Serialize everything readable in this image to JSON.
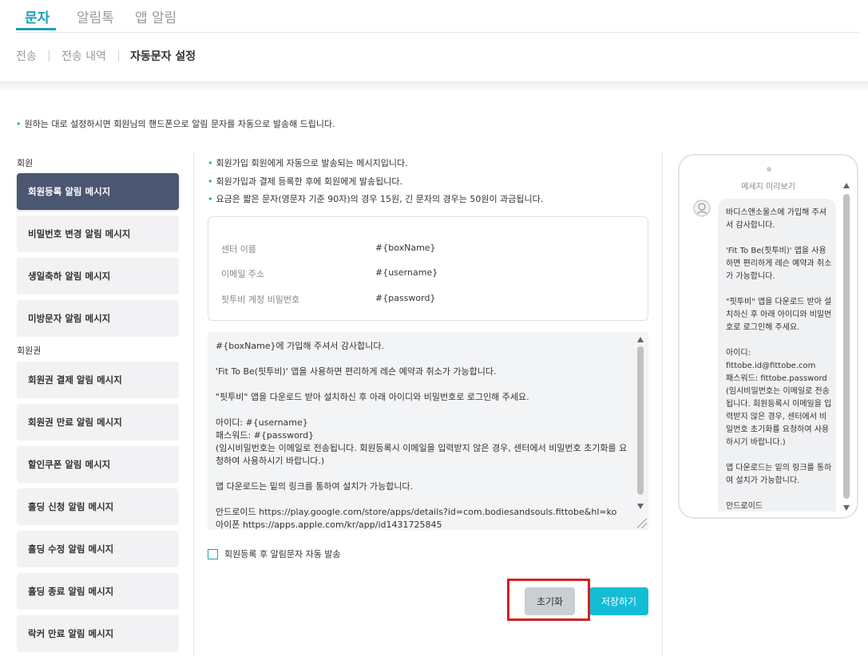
{
  "top_tabs": [
    {
      "label": "문자",
      "active": true
    },
    {
      "label": "알림톡",
      "active": false
    },
    {
      "label": "앱 알림",
      "active": false
    }
  ],
  "sub_tabs": [
    {
      "label": "전송"
    },
    {
      "label": "전송 내역"
    },
    {
      "label": "자동문자 설정",
      "active": true
    }
  ],
  "info": "원하는 대로 설정하시면 회원님의 핸드폰으로 알림 문자를 자동으로 발송해 드립니다.",
  "sidebar": {
    "groups": [
      {
        "label": "회원",
        "items": [
          "회원등록 알림 메시지",
          "비밀번호 변경 알림 메시지",
          "생일축하 알림 메시지",
          "미방문자 알림 메시지"
        ]
      },
      {
        "label": "회원권",
        "items": [
          "회원권 결제 알림 메시지",
          "회원권 만료 알림 메시지",
          "할인쿠폰 알림 메시지",
          "홀딩 신청 알림 메시지",
          "홀딩 수정 알림 메시지",
          "홀딩 종료 알림 메시지",
          "락커 만료 알림 메시지"
        ]
      }
    ],
    "active_item": "회원등록 알림 메시지"
  },
  "main": {
    "notes": [
      "회원가입 회원에게 자동으로 발송되는 메시지입니다.",
      "회원가입과 결제 등록한 후에 회원에게 발송됩니다.",
      "요금은 짧은 문자(영문자 기준 90자)의 경우 15원, 긴 문자의 경우는 50원이 과금됩니다."
    ],
    "variables": [
      {
        "name": "센터 이름",
        "value": "#{boxName}"
      },
      {
        "name": "이메일 주소",
        "value": "#{username}"
      },
      {
        "name": "핏투비 계정 비밀번호",
        "value": "#{password}"
      }
    ],
    "template_lines": [
      "#{boxName}에 가입해 주셔서 감사합니다.",
      "",
      "'Fit To Be(핏투비)' 앱을 사용하면 편리하게 레슨 예약과 취소가 가능합니다.",
      "",
      "\"핏투비\" 앱을 다운로드 받아 설치하신 후 아래 아이디와 비밀번호로 로그인해 주세요.",
      "",
      "아이디: #{username}",
      "패스워드: #{password}",
      "(임시비밀번호는 이메일로 전송됩니다. 회원등록시 이메일을 입력받지 않은 경우, 센터에서 비밀번호 초기화를 요청하여 사용하시기 바랍니다.)",
      "",
      "앱 다운로드는 밑의 링크를 통하여 설치가 가능합니다.",
      "",
      "안드로이드 https://play.google.com/store/apps/details?id=com.bodiesandsouls.fittobe&hl=ko",
      "아이폰 https://apps.apple.com/kr/app/id1431725845"
    ],
    "checkbox_label": "회원등록 후 알림문자 자동 발송",
    "checkbox_checked": false,
    "reset_label": "초기화",
    "save_label": "저장하기"
  },
  "preview": {
    "title": "메세지 미리보기",
    "lines": [
      "바디스앤소울스에 가입해 주셔서 감사합니다.",
      "",
      "'Fit To Be(핏투비)' 앱을 사용하면 편리하게 레슨 예약과 취소가 가능합니다.",
      "",
      "\"핏투비\" 앱을 다운로드 받아 설치하신 후 아래 아이디와 비밀번호로 로그인해 주세요.",
      "",
      "아이디:",
      "fittobe.id@fittobe.com",
      "패스워드: fittobe.password",
      "(임시비밀번호는 이메일로 전송됩니다. 회원등록시 이메일을 입력받지 않은 경우, 센터에서 비밀번호 초기화를 요청하여 사용하시기 바랍니다.)",
      "",
      "앱 다운로드는 밑의 링크를 통하여 설치가 가능합니다.",
      "",
      "안드로이드"
    ]
  },
  "colors": {
    "accent": "#1a9fb8",
    "sidebar_active": "#4b5670",
    "save_button": "#14bcd6",
    "reset_button": "#c8d0d3",
    "highlight": "#d42020"
  }
}
